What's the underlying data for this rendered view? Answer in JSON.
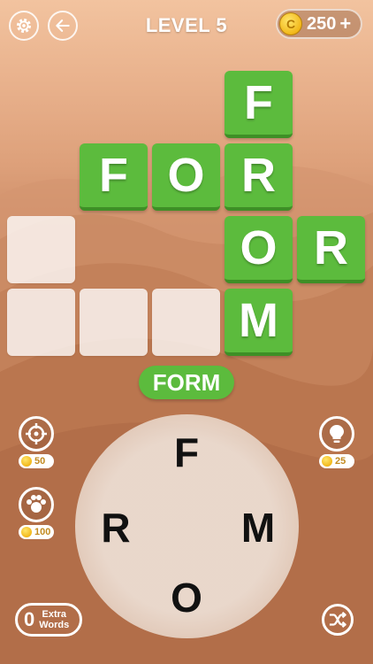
{
  "header": {
    "level_label": "LEVEL 5",
    "coins": "250",
    "coin_symbol": "C",
    "add_coins_label": "+",
    "settings_icon": "gear-icon",
    "back_icon": "arrow-left-icon"
  },
  "board": {
    "words_found": [
      "FOR",
      "FROM",
      "OR"
    ],
    "tiles": [
      {
        "letter": "F",
        "state": "filled"
      },
      {
        "letter": "F",
        "state": "filled"
      },
      {
        "letter": "O",
        "state": "filled"
      },
      {
        "letter": "R",
        "state": "filled"
      },
      {
        "letter": "",
        "state": "empty"
      },
      {
        "letter": "O",
        "state": "filled"
      },
      {
        "letter": "R",
        "state": "filled"
      },
      {
        "letter": "",
        "state": "empty"
      },
      {
        "letter": "",
        "state": "empty"
      },
      {
        "letter": "",
        "state": "empty"
      },
      {
        "letter": "M",
        "state": "filled"
      }
    ]
  },
  "current_word": "FORM",
  "wheel": {
    "letters": [
      "F",
      "R",
      "M",
      "O"
    ]
  },
  "powerups": {
    "target": {
      "icon": "crosshair-icon",
      "cost": "50"
    },
    "multi_reveal": {
      "icon": "paw-reveal-icon",
      "cost": "100"
    },
    "hint": {
      "icon": "lightbulb-icon",
      "cost": "25"
    }
  },
  "extra_words": {
    "count": "0",
    "label_line1": "Extra",
    "label_line2": "Words"
  },
  "shuffle": {
    "icon": "shuffle-icon"
  },
  "colors": {
    "tile_green": "#5cbb3d",
    "tile_green_dark": "#3e8f26",
    "coin_gold": "#f2b81a"
  }
}
